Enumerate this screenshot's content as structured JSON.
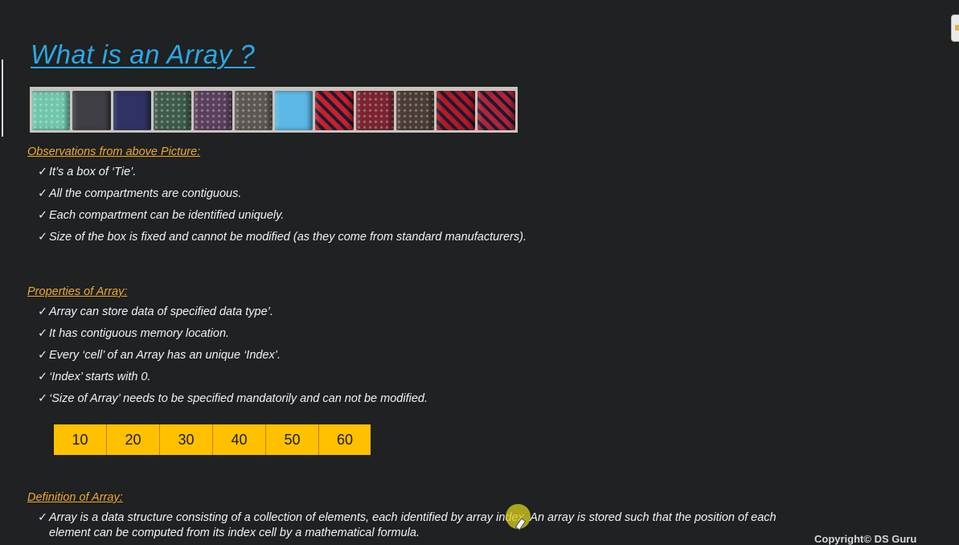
{
  "title": "What is an Array ?",
  "ties": [
    {
      "name": "mint-pattern-tie",
      "color": "#6fc6ad"
    },
    {
      "name": "charcoal-tie",
      "color": "#3f3f45"
    },
    {
      "name": "navy-tie",
      "color": "#2f3264"
    },
    {
      "name": "green-dotted-tie",
      "color": "#3e5a4b"
    },
    {
      "name": "paisley-tie",
      "color": "#5a3f5c"
    },
    {
      "name": "gray-paisley-tie",
      "color": "#5c5752"
    },
    {
      "name": "sky-blue-tie",
      "color": "#5cb9e6"
    },
    {
      "name": "red-striped-tie",
      "color": "#c8202e"
    },
    {
      "name": "maroon-dotted-tie",
      "color": "#7a2430"
    },
    {
      "name": "brown-pattern-tie",
      "color": "#4a3c35"
    },
    {
      "name": "black-red-striped-tie",
      "color": "#b31927"
    },
    {
      "name": "red-blue-striped-tie",
      "color": "#b2233a"
    }
  ],
  "observations": {
    "heading": "Observations from above Picture:",
    "items": [
      "It’s a box of ‘Tie’.",
      "All the compartments are contiguous.",
      "Each compartment can be identified uniquely.",
      "Size of the box is fixed and cannot be modified (as they come from standard manufacturers)."
    ]
  },
  "properties": {
    "heading": "Properties of Array:",
    "items": [
      "Array can store data of specified data type’.",
      "It has contiguous memory location.",
      "Every ‘cell’ of an Array has an unique ‘Index’.",
      "‘Index’ starts with 0.",
      "‘Size of Array’  needs to be specified mandatorily and can not be modified."
    ]
  },
  "array_cells": [
    "10",
    "20",
    "30",
    "40",
    "50",
    "60"
  ],
  "definition": {
    "heading": "Definition of Array:",
    "line1": "Array is a data structure consisting of a collection of elements, each identified by array index. An array is stored such that the position of each",
    "line2": "element can be computed from its index cell by a mathematical formula."
  },
  "copyright": "Copyright© DS Guru",
  "check_glyph": "✓",
  "colors": {
    "background": "#1f2122",
    "title": "#2aa8e6",
    "heading": "#f0a82a",
    "cell_fill": "#ffc000"
  }
}
